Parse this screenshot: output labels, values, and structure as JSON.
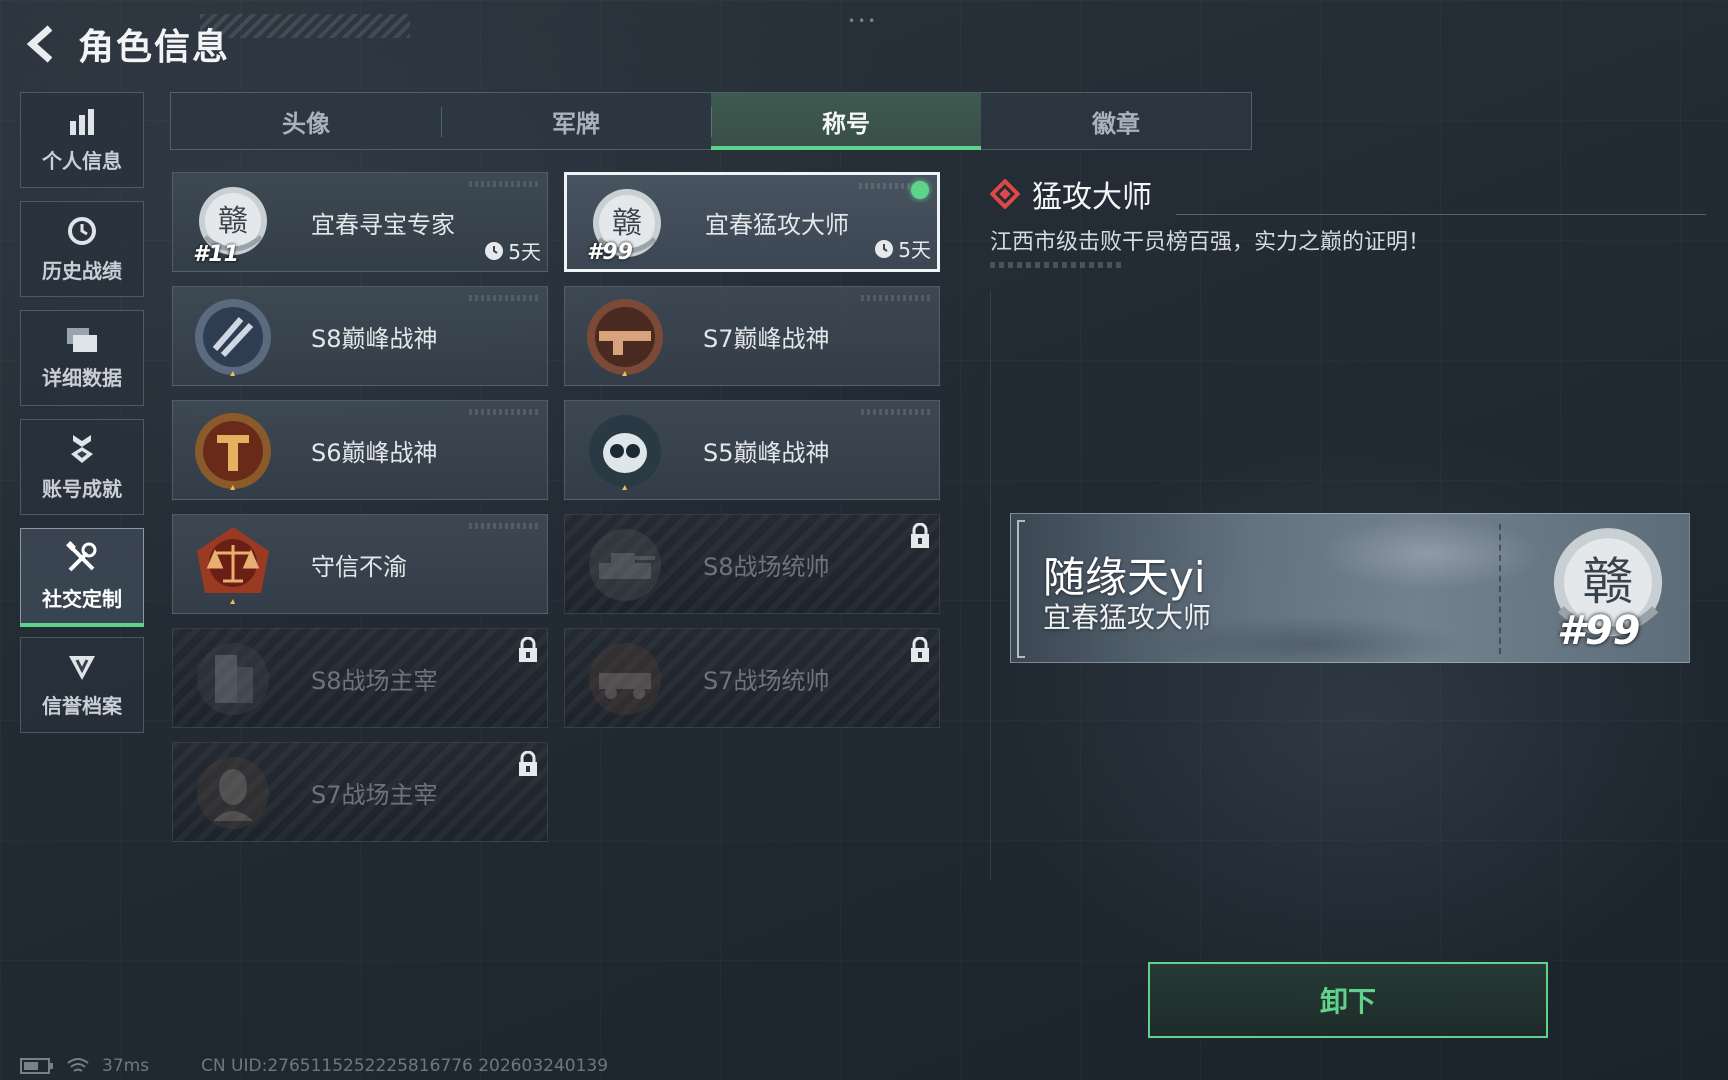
{
  "header": {
    "title": "角色信息"
  },
  "sidebar": {
    "items": [
      {
        "label": "个人信息",
        "icon": "bar-chart-icon"
      },
      {
        "label": "历史战绩",
        "icon": "history-clock-icon"
      },
      {
        "label": "详细数据",
        "icon": "folder-icon"
      },
      {
        "label": "账号成就",
        "icon": "medal-icon"
      },
      {
        "label": "社交定制",
        "icon": "tools-icon",
        "active": true
      },
      {
        "label": "信誉档案",
        "icon": "shield-icon"
      }
    ]
  },
  "tabs": [
    {
      "label": "头像"
    },
    {
      "label": "军牌"
    },
    {
      "label": "称号",
      "active": true
    },
    {
      "label": "徽章"
    }
  ],
  "titles": [
    {
      "name": "宜春寻宝专家",
      "rank": "#11",
      "timer": "5天",
      "badge": "city-seal-badge"
    },
    {
      "name": "宜春猛攻大师",
      "rank": "#99",
      "timer": "5天",
      "badge": "city-seal-badge",
      "selected": true,
      "equipped": true
    },
    {
      "name": "S8巅峰战神",
      "badge": "s8-peak-badge"
    },
    {
      "name": "S7巅峰战神",
      "badge": "s7-peak-badge"
    },
    {
      "name": "S6巅峰战神",
      "badge": "s6-peak-badge"
    },
    {
      "name": "S5巅峰战神",
      "badge": "s5-peak-badge"
    },
    {
      "name": "守信不渝",
      "badge": "scales-badge"
    },
    {
      "name": "S8战场统帅",
      "badge": "tank-badge",
      "locked": true
    },
    {
      "name": "S8战场主宰",
      "badge": "building-badge",
      "locked": true
    },
    {
      "name": "S7战场统帅",
      "badge": "vehicle-badge",
      "locked": true
    },
    {
      "name": "S7战场主宰",
      "badge": "soldier-badge",
      "locked": true
    }
  ],
  "detail": {
    "name": "猛攻大师",
    "description": "江西市级击败干员榜百强，实力之巅的证明！"
  },
  "nameplate": {
    "player_name": "随缘天yi",
    "title": "宜春猛攻大师",
    "rank": "#99"
  },
  "actions": {
    "unequip_label": "卸下"
  },
  "footer": {
    "ping": "37ms",
    "uid": "CN UID:276511525222581677​6 202603240139"
  },
  "colors": {
    "accent": "#5fd38a",
    "selected_border": "#f0f3f5",
    "diamond": "#e04848"
  }
}
